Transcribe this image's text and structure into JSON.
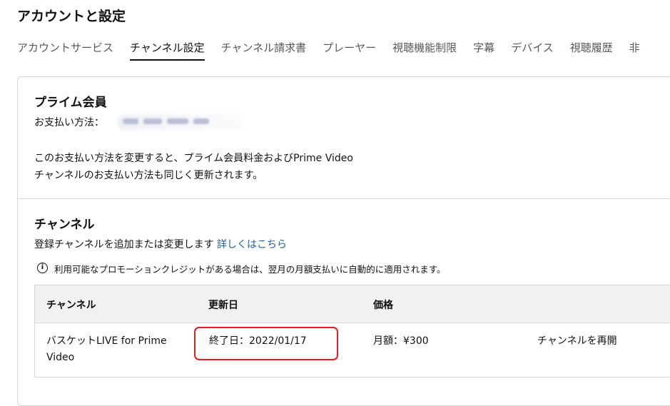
{
  "header": {
    "title": "アカウントと設定"
  },
  "tabs": [
    {
      "label": "アカウントサービス"
    },
    {
      "label": "チャンネル設定"
    },
    {
      "label": "チャンネル請求書"
    },
    {
      "label": "プレーヤー"
    },
    {
      "label": "視聴機能制限"
    },
    {
      "label": "字幕"
    },
    {
      "label": "デバイス"
    },
    {
      "label": "視聴履歴"
    },
    {
      "label": "非"
    }
  ],
  "active_tab": "チャンネル設定",
  "prime": {
    "title": "プライム会員",
    "payment_label": "お支払い方法：",
    "notice_line1": "このお支払い方法を変更すると、プライム会員料金およびPrime Video",
    "notice_line2": "チャンネルのお支払い方法も同じく更新されます。"
  },
  "channels": {
    "title": "チャンネル",
    "desc": "登録チャンネルを追加または変更します",
    "details_link": "詳しくはこちら",
    "info_note": "利用可能なプロモーションクレジットがある場合は、翌月の月額支払いに自動的に適用されます。",
    "table": {
      "headers": {
        "channel": "チャンネル",
        "renewal": "更新日",
        "price": "価格"
      },
      "rows": [
        {
          "channel_line1": "バスケットLIVE for Prime",
          "channel_line2": "Video",
          "renewal": "終了日：2022/01/17",
          "price": "月額：¥300",
          "action": "チャンネルを再開"
        }
      ]
    }
  },
  "colors": {
    "link": "#2162a1",
    "highlight": "#e02020",
    "header_bg": "#f0f2f2",
    "border": "#d5d9d9"
  }
}
